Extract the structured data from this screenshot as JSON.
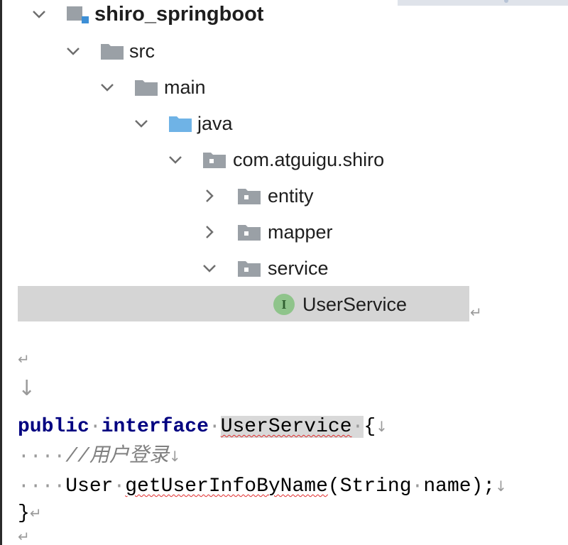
{
  "tree": {
    "root": "shiro_springboot",
    "src": "src",
    "main": "main",
    "java": "java",
    "package": "com.atguigu.shiro",
    "entity": "entity",
    "mapper": "mapper",
    "service": "service",
    "selected_file": "UserService",
    "interface_badge": "I"
  },
  "code": {
    "kw_public": "public",
    "kw_interface": "interface",
    "class_name": "UserService",
    "open_brace": "{",
    "comment": "//用户登录",
    "indent_dots": "····",
    "return_type": "User",
    "method_name": "getUserInfoByName",
    "params": "(String",
    "param_name": "name);",
    "close_brace": "}"
  },
  "marks": {
    "para": "↵",
    "down": "↓",
    "big_down": "↓",
    "space_dot": "·"
  },
  "colors": {
    "keyword": "#000080",
    "folder_blue": "#6fb3e6",
    "folder_gray": "#9aa0a6",
    "selection": "#d5d5d5",
    "interface_icon": "#8fc48b",
    "squiggle": "#e02b2b"
  }
}
